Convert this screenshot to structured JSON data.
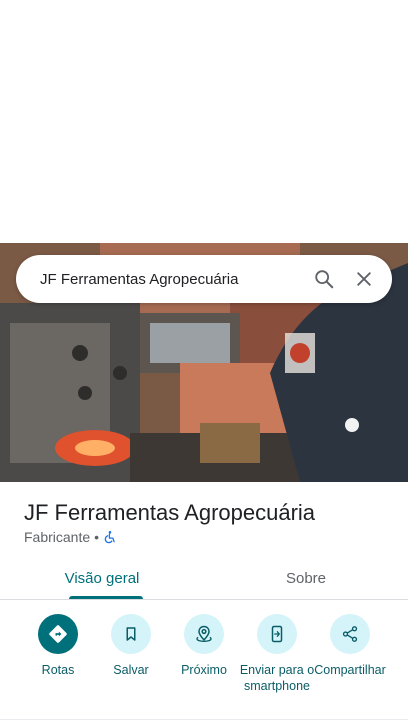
{
  "search": {
    "query": "JF Ferramentas Agropecuária",
    "search_icon": "search-icon",
    "close_icon": "close-icon"
  },
  "place": {
    "title": "JF Ferramentas Agropecuária",
    "category": "Fabricante",
    "separator": "•",
    "accessibility_icon": "wheelchair-icon",
    "accessibility_color": "#1a73e8"
  },
  "tabs": [
    {
      "label": "Visão geral",
      "active": true
    },
    {
      "label": "Sobre",
      "active": false
    }
  ],
  "actions": [
    {
      "label": "Rotas",
      "icon": "directions-icon"
    },
    {
      "label": "Salvar",
      "icon": "bookmark-icon"
    },
    {
      "label": "Próximo",
      "icon": "nearby-icon"
    },
    {
      "label": "Enviar para o smartphone",
      "icon": "send-to-phone-icon"
    },
    {
      "label": "Compartilhar",
      "icon": "share-icon"
    }
  ],
  "colors": {
    "accent": "#00707a",
    "action_circle": "#d5f4fa",
    "action_label": "#0a5d66"
  }
}
